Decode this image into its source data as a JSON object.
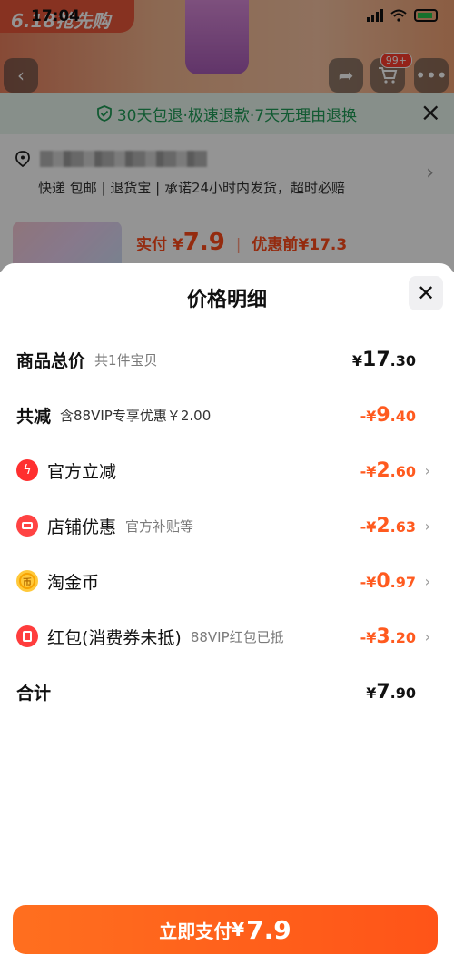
{
  "status_bar": {
    "time": "17:04"
  },
  "background": {
    "sale_tag": "6.18抢先购",
    "cart_badge": "99+",
    "return_banner": "30天包退·极速退款·7天无理由退换",
    "shipping_line": "快递 包邮 | 退货宝 | 承诺24小时内发货，超时必赔",
    "pay_label": "实付",
    "pay_currency": "¥",
    "pay_value": "7.9",
    "before_discount": "优惠前¥17.3"
  },
  "sheet": {
    "title": "价格明细",
    "rows": [
      {
        "label": "商品总价",
        "sub": "共1件宝贝",
        "currency": "¥",
        "num": "17",
        "dec": ".30"
      },
      {
        "label": "共减",
        "sub": "含88VIP专享优惠￥2.00",
        "currency": "-¥",
        "num": "9",
        "dec": ".40"
      },
      {
        "label": "官方立减",
        "sub": "",
        "currency": "-¥",
        "num": "2",
        "dec": ".60"
      },
      {
        "label": "店铺优惠",
        "sub": "官方补贴等",
        "currency": "-¥",
        "num": "2",
        "dec": ".63"
      },
      {
        "label": "淘金币",
        "sub": "",
        "currency": "-¥",
        "num": "0",
        "dec": ".97"
      },
      {
        "label": "红包(消费券未抵)",
        "sub": "88VIP红包已抵",
        "currency": "-¥",
        "num": "3",
        "dec": ".20"
      },
      {
        "label": "合计",
        "sub": "",
        "currency": "¥",
        "num": "7",
        "dec": ".90"
      }
    ]
  },
  "pay_button": {
    "label": "立即支付",
    "currency": "¥",
    "price": "7.9"
  },
  "colors": {
    "accent": "#ff5a1f",
    "return_green": "#1f9b57"
  }
}
